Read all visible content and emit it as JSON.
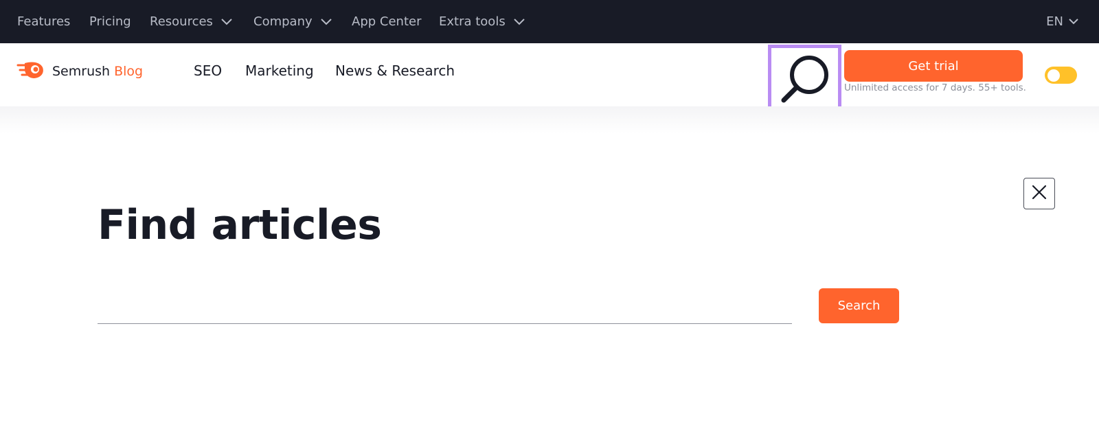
{
  "topnav": {
    "items": [
      {
        "label": "Features",
        "has_dropdown": false
      },
      {
        "label": "Pricing",
        "has_dropdown": false
      },
      {
        "label": "Resources",
        "has_dropdown": true
      },
      {
        "label": "Company",
        "has_dropdown": true
      },
      {
        "label": "App Center",
        "has_dropdown": false
      },
      {
        "label": "Extra tools",
        "has_dropdown": true
      }
    ],
    "language": "EN"
  },
  "header": {
    "logo": {
      "brand": "Semrush",
      "suffix": "Blog"
    },
    "nav": [
      "SEO",
      "Marketing",
      "News & Research"
    ],
    "trial_button": "Get trial",
    "trial_subtitle": "Unlimited access for 7 days. 55+ tools."
  },
  "search_panel": {
    "title": "Find articles",
    "input_value": "",
    "button_label": "Search"
  },
  "colors": {
    "topbar_bg": "#181b26",
    "accent": "#ff642d",
    "highlight": "#b98cf3",
    "toggle": "#ffc129"
  }
}
